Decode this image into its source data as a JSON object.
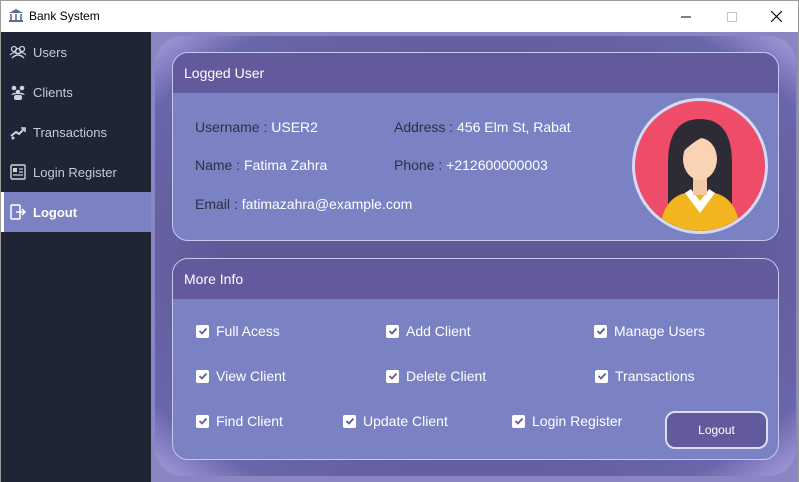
{
  "window": {
    "title": "Bank System"
  },
  "sidebar": {
    "items": [
      {
        "label": "Users",
        "icon": "users-icon"
      },
      {
        "label": "Clients",
        "icon": "clients-icon"
      },
      {
        "label": "Transactions",
        "icon": "transactions-icon"
      },
      {
        "label": "Login Register",
        "icon": "login-register-icon"
      },
      {
        "label": "Logout",
        "icon": "logout-icon",
        "active": true
      }
    ]
  },
  "logged_user": {
    "header": "Logged User",
    "username_label": "Username :",
    "username": "USER2",
    "address_label": "Address :",
    "address": "456 Elm St, Rabat",
    "name_label": "Name :",
    "name": "Fatima Zahra",
    "phone_label": "Phone :",
    "phone": "+212600000003",
    "email_label": "Email :",
    "email": "fatimazahra@example.com"
  },
  "more_info": {
    "header": "More Info",
    "permissions": [
      {
        "label": "Full Acess",
        "checked": true
      },
      {
        "label": "Add Client",
        "checked": true
      },
      {
        "label": "Manage Users",
        "checked": true
      },
      {
        "label": "View Client",
        "checked": true
      },
      {
        "label": "Delete Client",
        "checked": true
      },
      {
        "label": "Transactions",
        "checked": true
      },
      {
        "label": "Find Client",
        "checked": true
      },
      {
        "label": "Update Client",
        "checked": true
      },
      {
        "label": "Login Register",
        "checked": true
      }
    ],
    "logout_button": "Logout"
  },
  "colors": {
    "sidebar_bg": "#1f2535",
    "active_item": "#7a82c3",
    "card_bg": "#7a82c3",
    "card_header": "#625a9c",
    "avatar_circle": "#ee4c69"
  }
}
